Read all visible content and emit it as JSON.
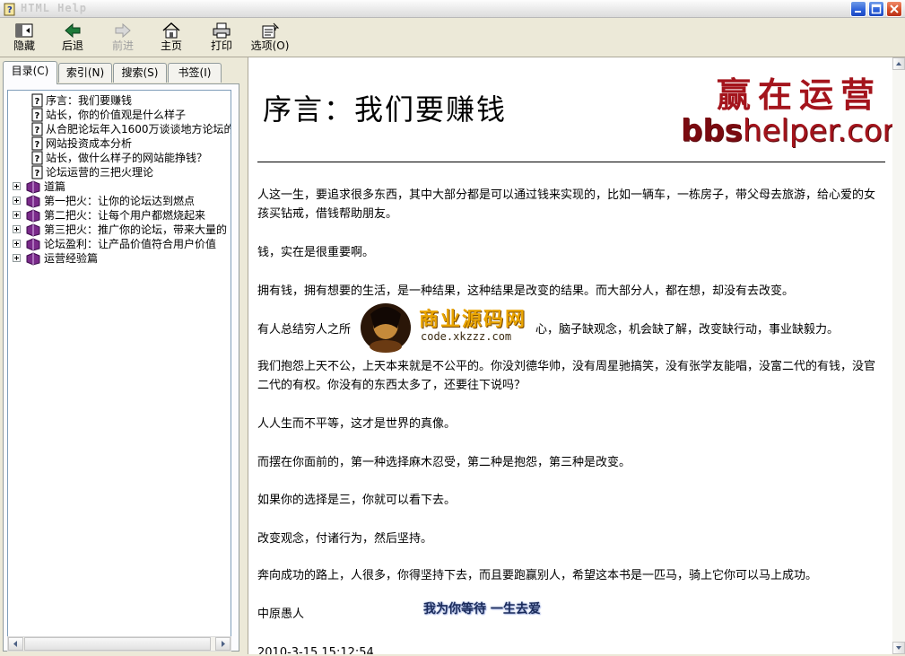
{
  "window": {
    "title": "HTML Help"
  },
  "toolbar": {
    "hide": "隐藏",
    "back": "后退",
    "forward": "前进",
    "home": "主页",
    "print": "打印",
    "options": "选项(O)"
  },
  "tabs": {
    "contents": "目录(C)",
    "index": "索引(N)",
    "search": "搜索(S)",
    "bookmarks": "书签(I)"
  },
  "tree": {
    "topics": [
      "序言：我们要赚钱",
      "站长，你的价值观是什么样子",
      "从合肥论坛年入1600万谈谈地方论坛的",
      "网站投资成本分析",
      "站长，做什么样子的网站能挣钱？",
      "论坛运营的三把火理论"
    ],
    "books": [
      "道篇",
      "第一把火：让你的论坛达到燃点",
      "第二把火：让每个用户都燃烧起来",
      "第三把火：推广你的论坛，带来大量的",
      "论坛盈利：让产品价值符合用户价值",
      "运营经验篇"
    ]
  },
  "article": {
    "title": "序言：我们要赚钱",
    "logo_cn": "赢在运营",
    "logo_en_bold": "bbs",
    "logo_en_rest": "helper.com",
    "p1": "人这一生，要追求很多东西，其中大部分都是可以通过钱来实现的，比如一辆车，一栋房子，带父母去旅游，给心爱的女孩买钻戒，借钱帮助朋友。",
    "p2": "钱，实在是很重要啊。",
    "p3": "拥有钱，拥有想要的生活，是一种结果，这种结果是改变的结果。而大部分人，都在想，却没有去改变。",
    "p4_start": "有人总结穷人之所",
    "p4_end": "心，脑子缺观念，机会缺了解，改变缺行动，事业缺毅力。",
    "p5": "我们抱怨上天不公，上天本来就是不公平的。你没刘德华帅，没有周星驰搞笑，没有张学友能唱，没富二代的有钱，没官二代的有权。你没有的东西太多了，还要往下说吗？",
    "p6": "人人生而不平等，这才是世界的真像。",
    "p7": "而摆在你面前的，第一种选择麻木忍受，第二种是抱怨，第三种是改变。",
    "p8": "如果你的选择是三，你就可以看下去。",
    "p9": "改变观念，付诸行为，然后坚持。",
    "p10": "奔向成功的路上，人很多，你得坚持下去，而且要跑赢别人，希望这本书是一匹马，骑上它你可以马上成功。",
    "signature": "中原愚人",
    "date": "2010-3-15 15:12:54"
  },
  "watermarks": {
    "site_cn": "商业源码网",
    "site_url": "code.xkzzz.com",
    "slogan": "我为你等待 一生去爱"
  },
  "colors": {
    "logo_red": "#a4141c",
    "xp_blue": "#2a5ed8",
    "xp_close": "#d24a22",
    "watermark_gold": "#e9a400"
  }
}
